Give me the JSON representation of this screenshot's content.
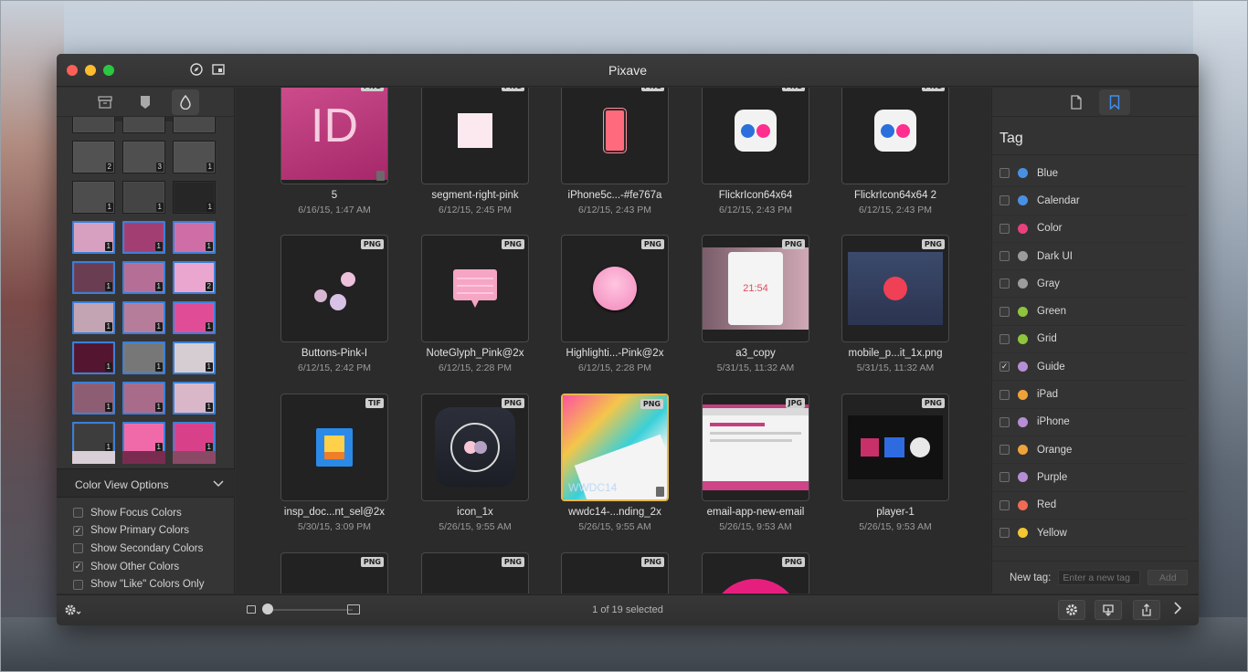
{
  "window": {
    "title": "Pixave"
  },
  "sidebar": {
    "tabs": [
      {
        "icon": "archive-icon"
      },
      {
        "icon": "tag-icon"
      },
      {
        "icon": "color-drop-icon",
        "active": true
      }
    ],
    "swatches": [
      {
        "color": "#4a4a4a",
        "count": "",
        "sel": false
      },
      {
        "color": "#4a4a4a",
        "count": "",
        "sel": false
      },
      {
        "color": "#4a4a4a",
        "count": "",
        "sel": false
      },
      {
        "color": "#525252",
        "count": "2",
        "sel": false
      },
      {
        "color": "#4f4f4f",
        "count": "3",
        "sel": false
      },
      {
        "color": "#505050",
        "count": "1",
        "sel": false
      },
      {
        "color": "#4d4d4d",
        "count": "1",
        "sel": false
      },
      {
        "color": "#444444",
        "count": "1",
        "sel": false
      },
      {
        "color": "#262626",
        "count": "1",
        "sel": false
      },
      {
        "color": "#d7a0c0",
        "count": "1",
        "sel": true
      },
      {
        "color": "#a33e72",
        "count": "1",
        "sel": true
      },
      {
        "color": "#cf6ea6",
        "count": "1",
        "sel": true
      },
      {
        "color": "#6a3d52",
        "count": "1",
        "sel": true
      },
      {
        "color": "#b56f97",
        "count": "1",
        "sel": true
      },
      {
        "color": "#eba6cf",
        "count": "2",
        "sel": true
      },
      {
        "color": "#c2a4b3",
        "count": "1",
        "sel": true
      },
      {
        "color": "#b67d9b",
        "count": "1",
        "sel": true
      },
      {
        "color": "#e04c96",
        "count": "1",
        "sel": true
      },
      {
        "color": "#53152f",
        "count": "1",
        "sel": true
      },
      {
        "color": "#777777",
        "count": "1",
        "sel": true
      },
      {
        "color": "#d6cdd2",
        "count": "1",
        "sel": true
      },
      {
        "color": "#8c5d73",
        "count": "1",
        "sel": true
      },
      {
        "color": "#a96b8a",
        "count": "1",
        "sel": true
      },
      {
        "color": "#d9b7c9",
        "count": "1",
        "sel": true
      },
      {
        "color": "#3d3d3d",
        "count": "1",
        "sel": true
      },
      {
        "color": "#f06aa9",
        "count": "1",
        "sel": true
      },
      {
        "color": "#d8418a",
        "count": "1",
        "sel": true
      }
    ],
    "bottom_strip_colors": [
      "#d8d0d6",
      "#7a2c50",
      "#8a4a66"
    ],
    "color_view_options": {
      "header": "Color View Options",
      "items": [
        {
          "label": "Show Focus Colors",
          "checked": false
        },
        {
          "label": "Show Primary Colors",
          "checked": true
        },
        {
          "label": "Show Secondary Colors",
          "checked": false
        },
        {
          "label": "Show Other Colors",
          "checked": true
        },
        {
          "label": "Show \"Like\" Colors Only",
          "checked": false
        }
      ]
    }
  },
  "grid": {
    "items": [
      {
        "name": "5",
        "date": "6/16/15, 1:47 AM",
        "format": "PNG",
        "kind": "indesign"
      },
      {
        "name": "segment-right-pink",
        "date": "6/12/15, 2:45 PM",
        "format": "PNG",
        "kind": "square"
      },
      {
        "name": "iPhone5c...-#fe767a",
        "date": "6/12/15, 2:43 PM",
        "format": "PNG",
        "kind": "iphone"
      },
      {
        "name": "FlickrIcon64x64",
        "date": "6/12/15, 2:43 PM",
        "format": "PNG",
        "kind": "flickr"
      },
      {
        "name": "FlickrIcon64x64 2",
        "date": "6/12/15, 2:43 PM",
        "format": "PNG",
        "kind": "flickr"
      },
      {
        "name": "Buttons-Pink-I",
        "date": "6/12/15, 2:42 PM",
        "format": "PNG",
        "kind": "buttons"
      },
      {
        "name": "NoteGlyph_Pink@2x",
        "date": "6/12/15, 2:28 PM",
        "format": "PNG",
        "kind": "note"
      },
      {
        "name": "Highlighti...-Pink@2x",
        "date": "6/12/15, 2:28 PM",
        "format": "PNG",
        "kind": "circle"
      },
      {
        "name": "a3_copy",
        "date": "5/31/15, 11:32 AM",
        "format": "PNG",
        "kind": "clock"
      },
      {
        "name": "mobile_p...it_1x.png",
        "date": "5/31/15, 11:32 AM",
        "format": "PNG",
        "kind": "pocket"
      },
      {
        "name": "insp_doc...nt_sel@2x",
        "date": "5/30/15, 3:09 PM",
        "format": "TIF",
        "kind": "doc"
      },
      {
        "name": "icon_1x",
        "date": "5/26/15, 9:55 AM",
        "format": "PNG",
        "kind": "toggle"
      },
      {
        "name": "wwdc14-...nding_2x",
        "date": "5/26/15, 9:55 AM",
        "format": "PNG",
        "kind": "wwdc"
      },
      {
        "name": "email-app-new-email",
        "date": "5/26/15, 9:53 AM",
        "format": "JPG",
        "kind": "email"
      },
      {
        "name": "player-1",
        "date": "5/26/15, 9:53 AM",
        "format": "PNG",
        "kind": "player"
      },
      {
        "name": "",
        "date": "",
        "format": "PNG",
        "kind": "menu"
      },
      {
        "name": "",
        "date": "",
        "format": "PNG",
        "kind": "calendar"
      },
      {
        "name": "",
        "date": "",
        "format": "PNG",
        "kind": "music"
      },
      {
        "name": "",
        "date": "",
        "format": "PNG",
        "kind": "face"
      }
    ],
    "selected_index": 12
  },
  "right_panel": {
    "tabs": [
      {
        "icon": "document-icon"
      },
      {
        "icon": "bookmark-icon",
        "active": true
      }
    ],
    "title": "Tag",
    "tags": [
      {
        "name": "Blue",
        "color": "#4a90e2",
        "checked": false
      },
      {
        "name": "Calendar",
        "color": "#4a90e2",
        "checked": false
      },
      {
        "name": "Color",
        "color": "#e8417e",
        "checked": false
      },
      {
        "name": "Dark UI",
        "color": "#9c9c9c",
        "checked": false
      },
      {
        "name": "Gray",
        "color": "#9c9c9c",
        "checked": false
      },
      {
        "name": "Green",
        "color": "#8fc53c",
        "checked": false
      },
      {
        "name": "Grid",
        "color": "#8fc53c",
        "checked": false
      },
      {
        "name": "Guide",
        "color": "#b68ed6",
        "checked": true
      },
      {
        "name": "iPad",
        "color": "#f0a23a",
        "checked": false
      },
      {
        "name": "iPhone",
        "color": "#b68ed6",
        "checked": false
      },
      {
        "name": "Orange",
        "color": "#f0a23a",
        "checked": false
      },
      {
        "name": "Purple",
        "color": "#b68ed6",
        "checked": false
      },
      {
        "name": "Red",
        "color": "#f06a55",
        "checked": false
      },
      {
        "name": "Yellow",
        "color": "#f3c733",
        "checked": false
      }
    ],
    "new_tag": {
      "label": "New tag:",
      "placeholder": "Enter a new tag",
      "add_label": "Add"
    }
  },
  "bottom_bar": {
    "status": "1 of 19 selected"
  }
}
